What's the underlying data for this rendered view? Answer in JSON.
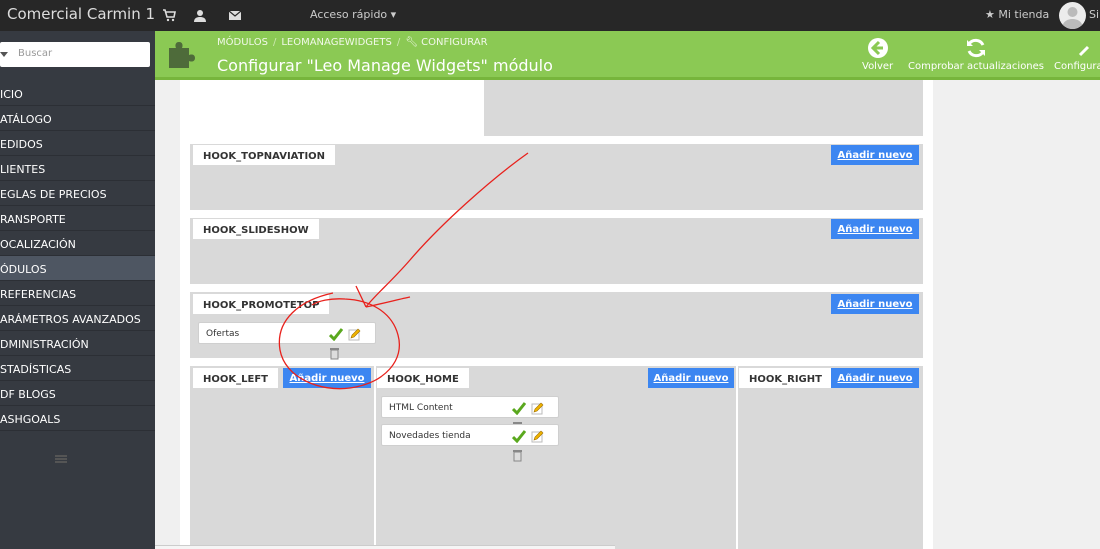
{
  "topbar": {
    "shop_name": "Comercial Carmin 1",
    "quick_access": "Acceso rápido",
    "my_store": "Mi tienda",
    "user_initial": "Si"
  },
  "sidebar": {
    "search_placeholder": "Buscar",
    "items": [
      {
        "label": "ICIO"
      },
      {
        "label": "ATÁLOGO"
      },
      {
        "label": "EDIDOS"
      },
      {
        "label": "LIENTES"
      },
      {
        "label": "EGLAS DE PRECIOS"
      },
      {
        "label": "RANSPORTE"
      },
      {
        "label": "OCALIZACIÓN"
      },
      {
        "label": "ÓDULOS"
      },
      {
        "label": "REFERENCIAS"
      },
      {
        "label": "ARÁMETROS AVANZADOS"
      },
      {
        "label": "DMINISTRACIÓN"
      },
      {
        "label": "STADÍSTICAS"
      },
      {
        "label": "DF BLOGS"
      },
      {
        "label": "ASHGOALS"
      }
    ]
  },
  "header": {
    "breadcrumb": {
      "modules": "MÓDULOS",
      "module": "LEOMANAGEWIDGETS",
      "configure": "CONFIGURAR"
    },
    "title": "Configurar \"Leo Manage Widgets\" módulo",
    "buttons": {
      "back": "Volver",
      "check_updates": "Comprobar actualizaciones",
      "configure": "Configurar"
    }
  },
  "hooks": {
    "add_label": "Añadir nuevo",
    "topnav": {
      "name": "HOOK_TOPNAVIATION"
    },
    "slideshow": {
      "name": "HOOK_SLIDESHOW"
    },
    "promotetop": {
      "name": "HOOK_PROMOTETOP",
      "widgets": [
        {
          "name": "Ofertas"
        }
      ]
    },
    "left": {
      "name": "HOOK_LEFT"
    },
    "home": {
      "name": "HOOK_HOME",
      "widgets": [
        {
          "name": "HTML Content"
        },
        {
          "name": "Novedades tienda"
        }
      ]
    },
    "right": {
      "name": "HOOK_RIGHT"
    }
  },
  "colors": {
    "header_green": "#8bc954",
    "button_blue": "#3c86f1",
    "sidebar_bg": "#363a41",
    "annotation_red": "#e8211c"
  }
}
